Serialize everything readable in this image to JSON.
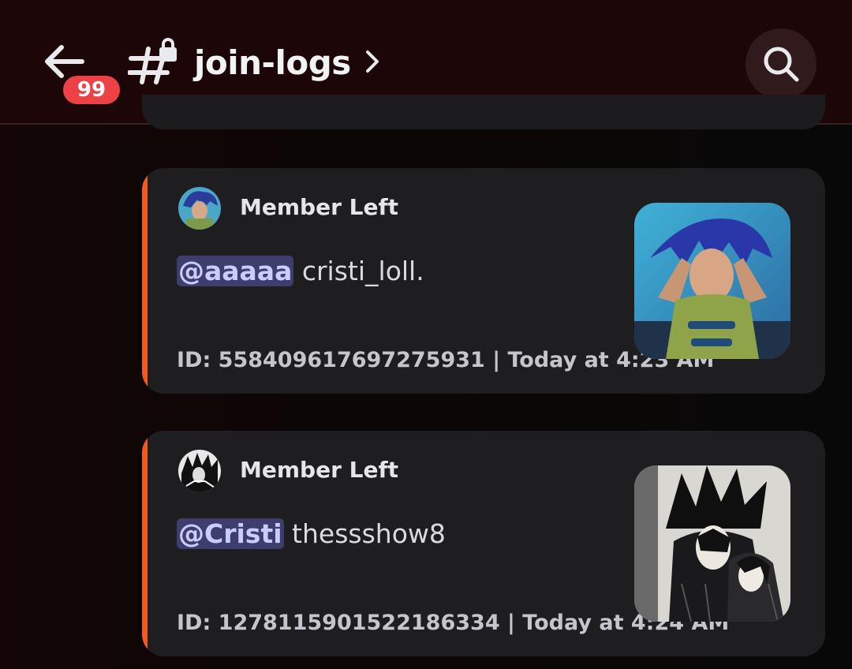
{
  "header": {
    "back_badge": "99",
    "channel_name": "join-logs"
  },
  "messages": [
    {
      "author": "Member Left",
      "mention": "@aaaaa",
      "text": "cristi_loll.",
      "footer": "ID: 558409617697275931 | Today at 4:23 AM",
      "accent": "#f05a1e"
    },
    {
      "author": "Member Left",
      "mention": "@Cristi",
      "text": "thessshow8",
      "footer": "ID: 1278115901522186334 | Today at 4:24 AM",
      "accent": "#f05a1e"
    }
  ],
  "colors": {
    "header_bg": "#1c0608",
    "badge": "#ed4245",
    "mention_bg": "#3e3d6e",
    "card_bg": "#1e1d20"
  }
}
